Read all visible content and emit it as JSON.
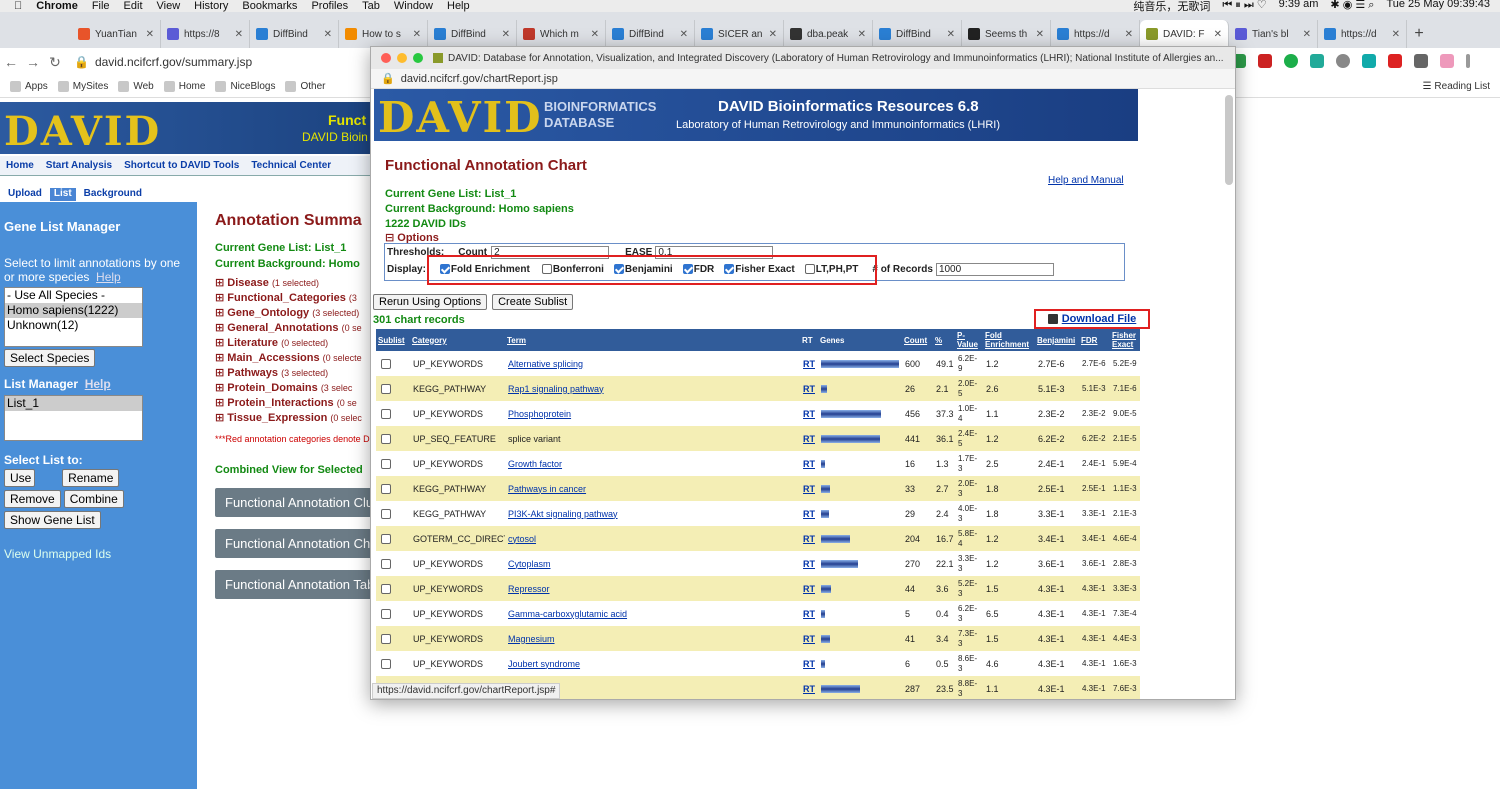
{
  "menubar": {
    "app": "Chrome",
    "items": [
      "File",
      "Edit",
      "View",
      "History",
      "Bookmarks",
      "Profiles",
      "Tab",
      "Window",
      "Help"
    ],
    "status_text": "纯音乐，无歌词",
    "time_short": "9:39 am",
    "clock": "Tue 25 May  09:39:43"
  },
  "tabs": [
    {
      "label": "YuanTian",
      "color": "#e8542a"
    },
    {
      "label": "https://8",
      "color": "#5b5bd6"
    },
    {
      "label": "DiffBind",
      "color": "#2a7fd4"
    },
    {
      "label": "How to s",
      "color": "#f28b00"
    },
    {
      "label": "DiffBind",
      "color": "#2a7fd4"
    },
    {
      "label": "Which m",
      "color": "#c0392b"
    },
    {
      "label": "DiffBind",
      "color": "#2a7fd4"
    },
    {
      "label": "SICER an",
      "color": "#2a7fd4"
    },
    {
      "label": "dba.peak",
      "color": "#333333"
    },
    {
      "label": "DiffBind",
      "color": "#2a7fd4"
    },
    {
      "label": "Seems th",
      "color": "#222222"
    },
    {
      "label": "https://d",
      "color": "#2a7fd4"
    },
    {
      "label": "DAVID: F",
      "color": "#8a9a2a"
    },
    {
      "label": "Tian's bl",
      "color": "#5b5bd6"
    },
    {
      "label": "https://d",
      "color": "#2a7fd4"
    }
  ],
  "back_url": "david.ncifcrf.gov/summary.jsp",
  "bookmarks": [
    "Apps",
    "MySites",
    "Web",
    "Home",
    "NiceBlogs",
    "Other"
  ],
  "reading_list": "Reading List",
  "bg": {
    "banner_title": "Funct",
    "banner_sub": "DAVID Bioin",
    "nav": [
      "Home",
      "Start Analysis",
      "Shortcut to DAVID Tools",
      "Technical Center"
    ],
    "subtabs": [
      "Upload",
      "List",
      "Background"
    ],
    "glm_title": "Gene List Manager",
    "glm_prompt": "Select to limit annotations by one or more species",
    "help": "Help",
    "species": [
      "- Use All Species -",
      "Homo sapiens(1222)",
      "Unknown(12)"
    ],
    "select_species": "Select Species",
    "list_manager": "List Manager",
    "lists": [
      "List_1"
    ],
    "select_list": "Select List to:",
    "use": "Use",
    "rename": "Rename",
    "remove": "Remove",
    "combine": "Combine",
    "show_gene_list": "Show Gene List",
    "unmapped": "View Unmapped Ids",
    "annot_title": "Annotation Summa",
    "current_list": "Current Gene List: List_1",
    "current_bg": "Current Background: Homo",
    "categories": [
      {
        "name": "Disease",
        "sel": "(1 selected)"
      },
      {
        "name": "Functional_Categories",
        "sel": "(3"
      },
      {
        "name": "Gene_Ontology",
        "sel": "(3 selected)"
      },
      {
        "name": "General_Annotations",
        "sel": "(0 se"
      },
      {
        "name": "Literature",
        "sel": "(0 selected)"
      },
      {
        "name": "Main_Accessions",
        "sel": "(0 selecte"
      },
      {
        "name": "Pathways",
        "sel": "(3 selected)"
      },
      {
        "name": "Protein_Domains",
        "sel": "(3 selec"
      },
      {
        "name": "Protein_Interactions",
        "sel": "(0 se"
      },
      {
        "name": "Tissue_Expression",
        "sel": "(0 selec"
      }
    ],
    "red_note": "***Red annotation categories denote D",
    "combined": "Combined View for Selected",
    "gray_buttons": [
      "Functional Annotation Clu",
      "Functional Annotation Cha",
      "Functional Annotation Tab"
    ]
  },
  "popup": {
    "window_title": "DAVID: Database for Annotation, Visualization, and Integrated Discovery (Laboratory of Human Retrovirology and Immunoinformatics (LHRI); National Institute of Allergies an...",
    "url": "david.ncifcrf.gov/chartReport.jsp",
    "banner_logo": "DAVID",
    "banner_sub1": "BIOINFORMATICS",
    "banner_sub2": "DATABASE",
    "banner_title": "DAVID Bioinformatics Resources 6.8",
    "banner_subtitle": "Laboratory of Human Retrovirology and Immunoinformatics (LHRI)",
    "chart_title": "Functional Annotation Chart",
    "help_manual": "Help and Manual",
    "current_list": "Current Gene List: List_1",
    "current_bg": "Current Background: Homo sapiens",
    "ids": "1222 DAVID IDs",
    "options": "⊟ Options",
    "thresholds": "Thresholds:",
    "count_lbl": "Count",
    "count_val": "2",
    "ease_lbl": "EASE",
    "ease_val": "0.1",
    "display_lbl": "Display:",
    "checks": [
      {
        "label": "Fold Enrichment",
        "on": true
      },
      {
        "label": "Bonferroni",
        "on": false
      },
      {
        "label": "Benjamini",
        "on": true
      },
      {
        "label": "FDR",
        "on": true
      },
      {
        "label": "Fisher Exact",
        "on": true
      },
      {
        "label": "LT,PH,PT",
        "on": false
      }
    ],
    "records_lbl": "# of Records",
    "records_val": "1000",
    "rerun": "Rerun Using Options",
    "create_sublist": "Create Sublist",
    "chart_records": "301 chart records",
    "download": "Download File",
    "headers": [
      "Sublist",
      "Category",
      "Term",
      "RT",
      "Genes",
      "Count",
      "%",
      "P-Value",
      "Fold Enrichment",
      "Benjamini",
      "FDR",
      "Fisher Exact"
    ],
    "rows": [
      {
        "cat": "UP_KEYWORDS",
        "term": "Alternative splicing",
        "link": true,
        "genes": 1.0,
        "count": "600",
        "pct": "49.1",
        "p": "6.2E-9",
        "fold": "1.2",
        "benj": "2.7E-6",
        "fdr": "2.7E-6",
        "fisher": "5.2E-9"
      },
      {
        "cat": "KEGG_PATHWAY",
        "term": "Rap1 signaling pathway",
        "link": true,
        "genes": 0.08,
        "count": "26",
        "pct": "2.1",
        "p": "2.0E-5",
        "fold": "2.6",
        "benj": "5.1E-3",
        "fdr": "5.1E-3",
        "fisher": "7.1E-6"
      },
      {
        "cat": "UP_KEYWORDS",
        "term": "Phosphoprotein",
        "link": true,
        "genes": 0.77,
        "count": "456",
        "pct": "37.3",
        "p": "1.0E-4",
        "fold": "1.1",
        "benj": "2.3E-2",
        "fdr": "2.3E-2",
        "fisher": "9.0E-5"
      },
      {
        "cat": "UP_SEQ_FEATURE",
        "term": "splice variant",
        "link": false,
        "genes": 0.75,
        "count": "441",
        "pct": "36.1",
        "p": "2.4E-5",
        "fold": "1.2",
        "benj": "6.2E-2",
        "fdr": "6.2E-2",
        "fisher": "2.1E-5"
      },
      {
        "cat": "UP_KEYWORDS",
        "term": "Growth factor",
        "link": true,
        "genes": 0.05,
        "count": "16",
        "pct": "1.3",
        "p": "1.7E-3",
        "fold": "2.5",
        "benj": "2.4E-1",
        "fdr": "2.4E-1",
        "fisher": "5.9E-4"
      },
      {
        "cat": "KEGG_PATHWAY",
        "term": "Pathways in cancer",
        "link": true,
        "genes": 0.11,
        "count": "33",
        "pct": "2.7",
        "p": "2.0E-3",
        "fold": "1.8",
        "benj": "2.5E-1",
        "fdr": "2.5E-1",
        "fisher": "1.1E-3"
      },
      {
        "cat": "KEGG_PATHWAY",
        "term": "PI3K-Akt signaling pathway",
        "link": true,
        "genes": 0.1,
        "count": "29",
        "pct": "2.4",
        "p": "4.0E-3",
        "fold": "1.8",
        "benj": "3.3E-1",
        "fdr": "3.3E-1",
        "fisher": "2.1E-3"
      },
      {
        "cat": "GOTERM_CC_DIRECT",
        "term": "cytosol",
        "link": true,
        "genes": 0.37,
        "count": "204",
        "pct": "16.7",
        "p": "5.8E-4",
        "fold": "1.2",
        "benj": "3.4E-1",
        "fdr": "3.4E-1",
        "fisher": "4.6E-4"
      },
      {
        "cat": "UP_KEYWORDS",
        "term": "Cytoplasm",
        "link": true,
        "genes": 0.47,
        "count": "270",
        "pct": "22.1",
        "p": "3.3E-3",
        "fold": "1.2",
        "benj": "3.6E-1",
        "fdr": "3.6E-1",
        "fisher": "2.8E-3"
      },
      {
        "cat": "UP_KEYWORDS",
        "term": "Repressor",
        "link": true,
        "genes": 0.13,
        "count": "44",
        "pct": "3.6",
        "p": "5.2E-3",
        "fold": "1.5",
        "benj": "4.3E-1",
        "fdr": "4.3E-1",
        "fisher": "3.3E-3"
      },
      {
        "cat": "UP_KEYWORDS",
        "term": "Gamma-carboxyglutamic acid",
        "link": true,
        "genes": 0.03,
        "count": "5",
        "pct": "0.4",
        "p": "6.2E-3",
        "fold": "6.5",
        "benj": "4.3E-1",
        "fdr": "4.3E-1",
        "fisher": "7.3E-4"
      },
      {
        "cat": "UP_KEYWORDS",
        "term": "Magnesium",
        "link": true,
        "genes": 0.12,
        "count": "41",
        "pct": "3.4",
        "p": "7.3E-3",
        "fold": "1.5",
        "benj": "4.3E-1",
        "fdr": "4.3E-1",
        "fisher": "4.4E-3"
      },
      {
        "cat": "UP_KEYWORDS",
        "term": "Joubert syndrome",
        "link": true,
        "genes": 0.03,
        "count": "6",
        "pct": "0.5",
        "p": "8.6E-3",
        "fold": "4.6",
        "benj": "4.3E-1",
        "fdr": "4.3E-1",
        "fisher": "1.6E-3"
      },
      {
        "cat": "",
        "term": "",
        "link": false,
        "genes": 0.5,
        "count": "287",
        "pct": "23.5",
        "p": "8.8E-3",
        "fold": "1.1",
        "benj": "4.3E-1",
        "fdr": "4.3E-1",
        "fisher": "7.6E-3"
      }
    ],
    "status_url": "https://david.ncifcrf.gov/chartReport.jsp#"
  }
}
